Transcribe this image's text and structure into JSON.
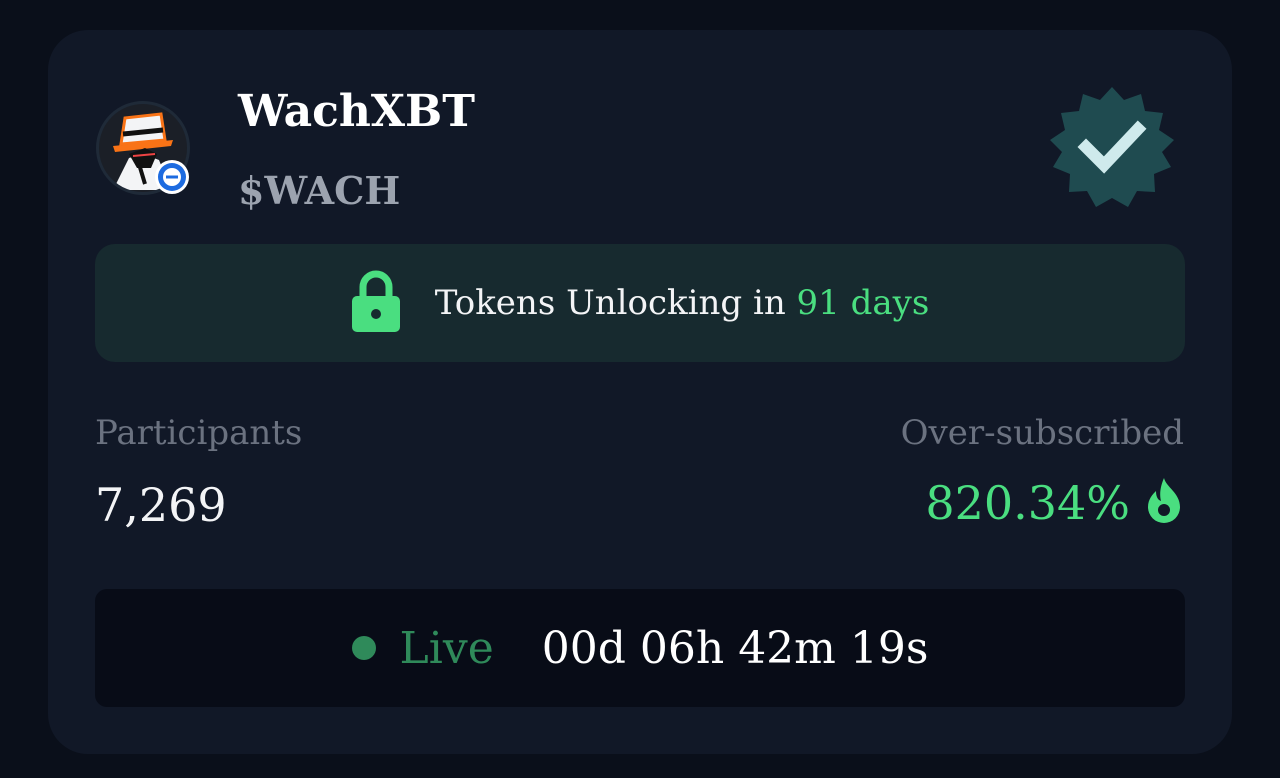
{
  "project": {
    "name": "WachXBT",
    "ticker": "$WACH"
  },
  "unlock": {
    "prefix": "Tokens Unlocking in",
    "days": "91 days"
  },
  "stats": {
    "participants_label": "Participants",
    "participants_value": "7,269",
    "oversubscribed_label": "Over-subscribed",
    "oversubscribed_value": "820.34%"
  },
  "status": {
    "live_label": "Live",
    "countdown": "00d 06h 42m 19s"
  },
  "icons": {
    "avatar": "avatar-image",
    "chain": "chain-badge-icon",
    "verified": "verified-badge-icon",
    "lock": "lock-icon",
    "fire": "fire-icon",
    "live": "live-dot-icon"
  },
  "colors": {
    "accent_green": "#4ade80",
    "live_green": "#2f8a5a",
    "verified_teal": "#1f4b50",
    "chain_blue": "#1d6be0"
  }
}
